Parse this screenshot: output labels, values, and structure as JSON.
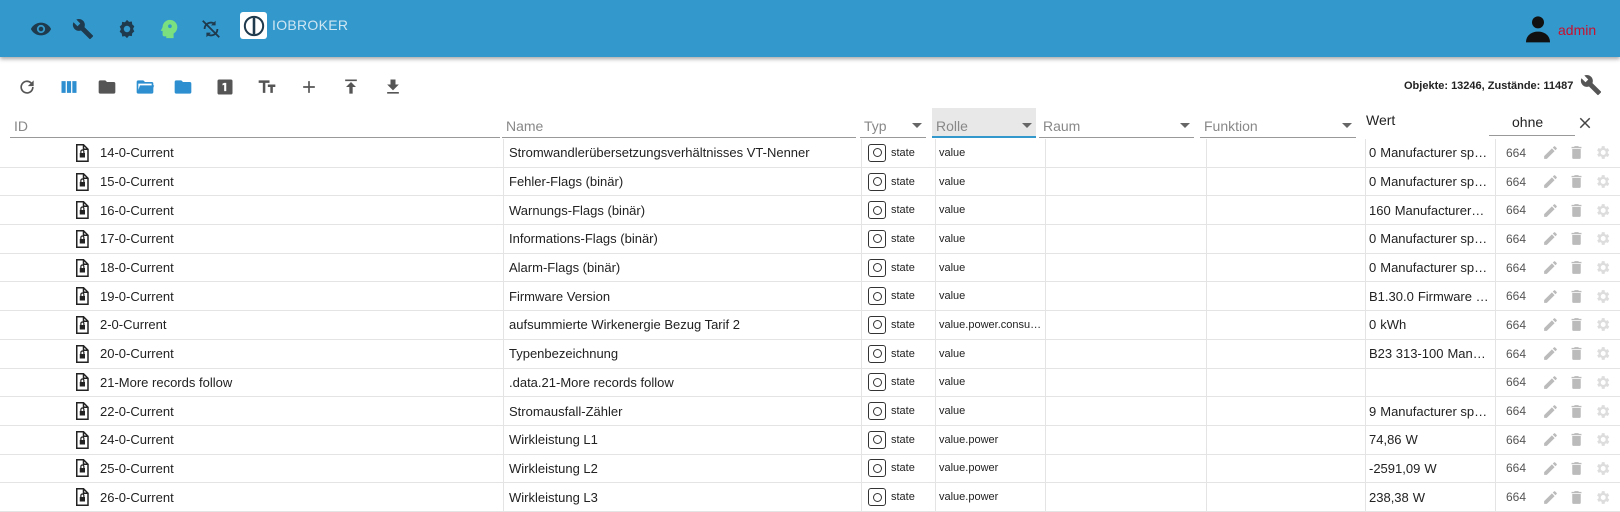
{
  "appbar": {
    "brand": "IOBROKER",
    "user": "admin",
    "icons": [
      "eye-icon",
      "wrench-icon",
      "adapter-icon",
      "head-icon",
      "sync-icon"
    ]
  },
  "toolbar": {
    "icons": [
      "refresh-icon",
      "columns-icon",
      "folder-icon",
      "folder-open-icon",
      "folder-blue-icon",
      "one-icon",
      "text-size-icon",
      "plus-icon",
      "upload-icon",
      "download-icon"
    ],
    "counter": "Objekte: 13246, Zustände: 11487"
  },
  "columns": {
    "id": "ID",
    "name": "Name",
    "typ": "Typ",
    "rolle": "Rolle",
    "raum": "Raum",
    "funktion": "Funktion",
    "wert": "Wert",
    "filter": "ohne"
  },
  "rows": [
    {
      "id": "14-0-Current",
      "name": "Stromwandlerübersetzungsverhältnisses VT-Nenner",
      "type": "state",
      "role": "value",
      "value": "0",
      "unit": "Manufacturer sp…",
      "acl": "664"
    },
    {
      "id": "15-0-Current",
      "name": "Fehler-Flags (binär)",
      "type": "state",
      "role": "value",
      "value": "0",
      "unit": "Manufacturer sp…",
      "acl": "664"
    },
    {
      "id": "16-0-Current",
      "name": "Warnungs-Flags (binär)",
      "type": "state",
      "role": "value",
      "value": "160",
      "unit": "Manufacturer…",
      "acl": "664"
    },
    {
      "id": "17-0-Current",
      "name": "Informations-Flags (binär)",
      "type": "state",
      "role": "value",
      "value": "0",
      "unit": "Manufacturer sp…",
      "acl": "664"
    },
    {
      "id": "18-0-Current",
      "name": "Alarm-Flags (binär)",
      "type": "state",
      "role": "value",
      "value": "0",
      "unit": "Manufacturer sp…",
      "acl": "664"
    },
    {
      "id": "19-0-Current",
      "name": "Firmware Version",
      "type": "state",
      "role": "value",
      "value": "B1.30.0",
      "unit": "Firmware …",
      "acl": "664"
    },
    {
      "id": "2-0-Current",
      "name": "aufsummierte Wirkenergie Bezug Tarif 2",
      "type": "state",
      "role": "value.power.consu…",
      "value": "0",
      "unit": "kWh",
      "acl": "664"
    },
    {
      "id": "20-0-Current",
      "name": "Typenbezeichnung",
      "type": "state",
      "role": "value",
      "value": "B23 313-100",
      "unit": "Man…",
      "acl": "664"
    },
    {
      "id": "21-More records follow",
      "name": ".data.21-More records follow",
      "type": "state",
      "role": "value",
      "value": "",
      "unit": "",
      "acl": "664"
    },
    {
      "id": "22-0-Current",
      "name": "Stromausfall-Zähler",
      "type": "state",
      "role": "value",
      "value": "9",
      "unit": "Manufacturer sp…",
      "acl": "664"
    },
    {
      "id": "24-0-Current",
      "name": "Wirkleistung L1",
      "type": "state",
      "role": "value.power",
      "value": "74,86",
      "unit": "W",
      "acl": "664"
    },
    {
      "id": "25-0-Current",
      "name": "Wirkleistung L2",
      "type": "state",
      "role": "value.power",
      "value": "-2591,09",
      "unit": "W",
      "acl": "664"
    },
    {
      "id": "26-0-Current",
      "name": "Wirkleistung L3",
      "type": "state",
      "role": "value.power",
      "value": "238,38",
      "unit": "W",
      "acl": "664"
    }
  ]
}
